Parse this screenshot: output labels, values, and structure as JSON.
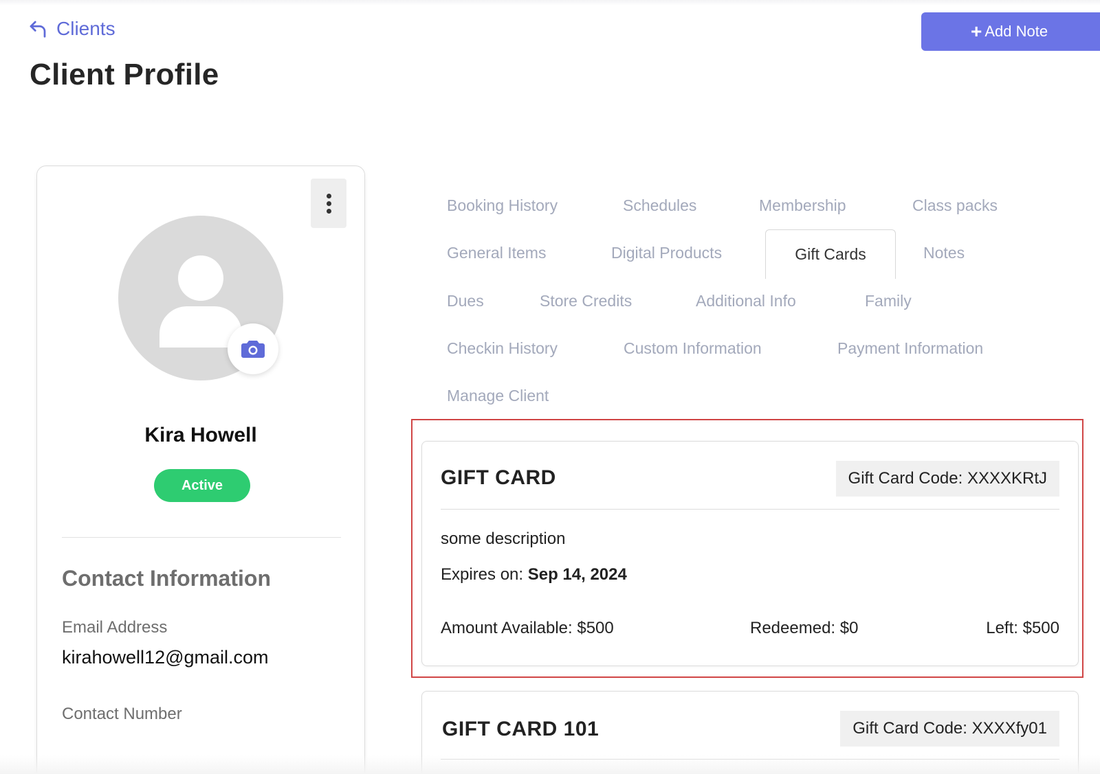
{
  "header": {
    "back_label": "Clients",
    "page_title": "Client Profile",
    "add_note_label": "Add Note"
  },
  "profile": {
    "name": "Kira Howell",
    "status": "Active",
    "status_color": "#2ecc71",
    "contact_heading": "Contact Information",
    "email_label": "Email Address",
    "email_value": "kirahowell12@gmail.com",
    "phone_label": "Contact Number"
  },
  "tabs": [
    "Booking History",
    "Schedules",
    "Membership",
    "Class packs",
    "General Items",
    "Digital Products",
    "Gift Cards",
    "Notes",
    "Dues",
    "Store Credits",
    "Additional Info",
    "Family",
    "Checkin History",
    "Custom Information",
    "Payment Information",
    "Manage Client"
  ],
  "active_tab": "Gift Cards",
  "gift_cards": [
    {
      "title": "GIFT CARD",
      "code": "Gift Card Code: XXXXKRtJ",
      "description": "some description",
      "expires_label": "Expires on: ",
      "expires_value": "Sep 14, 2024",
      "amount_available": "Amount Available: $500",
      "redeemed": "Redeemed: $0",
      "left": "Left: $500"
    },
    {
      "title": "GIFT CARD 101",
      "code": "Gift Card Code: XXXXfy01"
    }
  ],
  "colors": {
    "accent": "#6b74e6",
    "link": "#5f6bd8",
    "highlight": "#d04545",
    "tab_inactive": "#a3a9bb"
  }
}
